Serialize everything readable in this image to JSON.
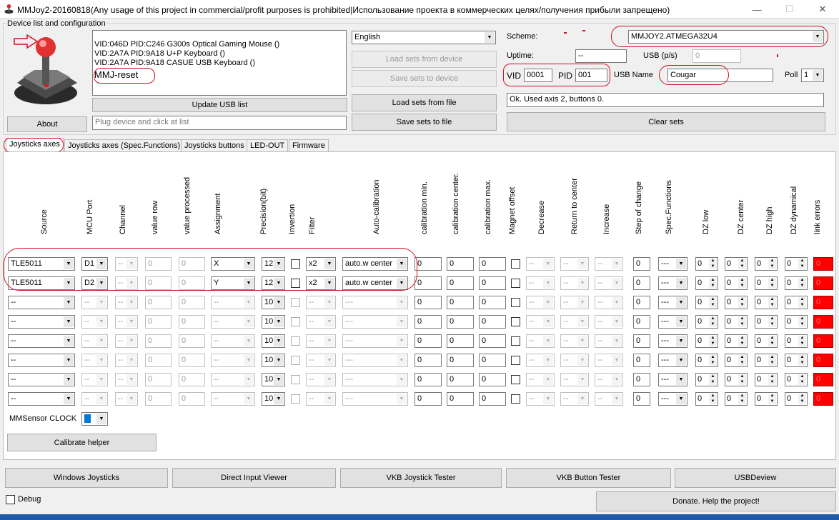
{
  "window": {
    "title": "MMJoy2-20160818(Any usage of this project in commercial/profit purposes is prohibited|Использование проекта в коммерческих целях/получения прибыли запрещено)",
    "minimize": "—",
    "maximize": "☐",
    "close": "✕"
  },
  "device_group": {
    "caption": "Device list and configuration",
    "devices": [
      "VID:046D PID:C246 G300s Optical Gaming Mouse ()",
      "VID:2A7A PID:9A18 U+P Keyboard ()",
      "VID:2A7A PID:9A18 CASUE USB Keyboard ()",
      "MMJ-reset"
    ],
    "about_label": "About",
    "update_usb_label": "Update USB list",
    "plug_placeholder": "Plug device and click at list"
  },
  "middle": {
    "language": "English",
    "load_device_label": "Load sets from device",
    "save_device_label": "Save sets to device",
    "load_file_label": "Load sets from file",
    "save_file_label": "Save sets to file"
  },
  "config": {
    "scheme_label": "Scheme:",
    "scheme_value": "MMJOY2.ATMEGA32U4",
    "uptime_label": "Uptime:",
    "uptime_value": "--",
    "usb_ps_label": "USB (p/s)",
    "usb_ps_value": "0",
    "vid_label": "VID",
    "vid_value": "0001",
    "pid_label": "PID",
    "pid_value": "001",
    "usb_name_label": "USB Name",
    "usb_name_value": "Cougar",
    "poll_label": "Poll",
    "poll_value": "1",
    "status_text": "Ok. Used axis  2, buttons 0.",
    "clear_sets_label": "Clear sets"
  },
  "tabs": [
    "Joysticks axes",
    "Joysticks axes (Spec.Functions)",
    "Joysticks buttons",
    "LED-OUT",
    "Firmware"
  ],
  "columns": [
    "Source",
    "MCU Port",
    "Channel",
    "value row",
    "value processed",
    "Assignment",
    "Precision(bit)",
    "Invertion",
    "Filter",
    "Auto-calibration",
    "calibration min.",
    "calibration center.",
    "calibration max.",
    "Magnet offset",
    "Decrease",
    "Return to center",
    "Increase",
    "Step of change",
    "Spec.Functions",
    "DZ low",
    "DZ center",
    "DZ high",
    "DZ dynamical",
    "link errors"
  ],
  "rows": [
    {
      "source": "TLE5011",
      "port": "D1",
      "channel": "--",
      "raw": "0",
      "proc": "0",
      "assign": "X",
      "prec": "12",
      "filter": "x2",
      "autocal": "auto.w center",
      "cmin": "0",
      "ccen": "0",
      "cmax": "0",
      "dec": "--",
      "ret": "--",
      "inc": "--",
      "step": "0",
      "spec": "---",
      "dzl": "0",
      "dzc": "0",
      "dzh": "0",
      "dzd": "0",
      "err": "0"
    },
    {
      "source": "TLE5011",
      "port": "D2",
      "channel": "--",
      "raw": "0",
      "proc": "0",
      "assign": "Y",
      "prec": "12",
      "filter": "x2",
      "autocal": "auto.w center",
      "cmin": "0",
      "ccen": "0",
      "cmax": "0",
      "dec": "--",
      "ret": "--",
      "inc": "--",
      "step": "0",
      "spec": "---",
      "dzl": "0",
      "dzc": "0",
      "dzh": "0",
      "dzd": "0",
      "err": "0"
    },
    {
      "source": "--",
      "port": "--",
      "channel": "--",
      "raw": "0",
      "proc": "0",
      "assign": "--",
      "prec": "10",
      "filter": "--",
      "autocal": "---",
      "cmin": "0",
      "ccen": "0",
      "cmax": "0",
      "dec": "--",
      "ret": "--",
      "inc": "--",
      "step": "0",
      "spec": "---",
      "dzl": "0",
      "dzc": "0",
      "dzh": "0",
      "dzd": "0",
      "err": "0"
    },
    {
      "source": "--",
      "port": "--",
      "channel": "--",
      "raw": "0",
      "proc": "0",
      "assign": "--",
      "prec": "10",
      "filter": "--",
      "autocal": "---",
      "cmin": "0",
      "ccen": "0",
      "cmax": "0",
      "dec": "--",
      "ret": "--",
      "inc": "--",
      "step": "0",
      "spec": "---",
      "dzl": "0",
      "dzc": "0",
      "dzh": "0",
      "dzd": "0",
      "err": "0"
    },
    {
      "source": "--",
      "port": "--",
      "channel": "--",
      "raw": "0",
      "proc": "0",
      "assign": "--",
      "prec": "10",
      "filter": "--",
      "autocal": "---",
      "cmin": "0",
      "ccen": "0",
      "cmax": "0",
      "dec": "--",
      "ret": "--",
      "inc": "--",
      "step": "0",
      "spec": "---",
      "dzl": "0",
      "dzc": "0",
      "dzh": "0",
      "dzd": "0",
      "err": "0"
    },
    {
      "source": "--",
      "port": "--",
      "channel": "--",
      "raw": "0",
      "proc": "0",
      "assign": "--",
      "prec": "10",
      "filter": "--",
      "autocal": "---",
      "cmin": "0",
      "ccen": "0",
      "cmax": "0",
      "dec": "--",
      "ret": "--",
      "inc": "--",
      "step": "0",
      "spec": "---",
      "dzl": "0",
      "dzc": "0",
      "dzh": "0",
      "dzd": "0",
      "err": "0"
    },
    {
      "source": "--",
      "port": "--",
      "channel": "--",
      "raw": "0",
      "proc": "0",
      "assign": "--",
      "prec": "10",
      "filter": "--",
      "autocal": "---",
      "cmin": "0",
      "ccen": "0",
      "cmax": "0",
      "dec": "--",
      "ret": "--",
      "inc": "--",
      "step": "0",
      "spec": "---",
      "dzl": "0",
      "dzc": "0",
      "dzh": "0",
      "dzd": "0",
      "err": "0"
    },
    {
      "source": "--",
      "port": "--",
      "channel": "--",
      "raw": "0",
      "proc": "0",
      "assign": "--",
      "prec": "10",
      "filter": "--",
      "autocal": "---",
      "cmin": "0",
      "ccen": "0",
      "cmax": "0",
      "dec": "--",
      "ret": "--",
      "inc": "--",
      "step": "0",
      "spec": "---",
      "dzl": "0",
      "dzc": "0",
      "dzh": "0",
      "dzd": "0",
      "err": "0"
    }
  ],
  "mmsensor": {
    "label": "MMSensor CLOCK",
    "value": "2"
  },
  "calibrate_helper_label": "Calibrate helper",
  "bottom_buttons": [
    "Windows Joysticks",
    "Direct Input Viewer",
    "VKB Joystick Tester",
    "VKB Button Tester",
    "USBDeview"
  ],
  "debug_label": "Debug",
  "donate_label": "Donate. Help the project!",
  "icons": {
    "app": "joystick-icon",
    "device": "joystick-icon",
    "pointer": "arrow-right-icon",
    "dropdown": "chevron-down-icon",
    "spin": "spin-arrows-icon"
  },
  "colors": {
    "link_error": "#ff0000",
    "annotation": "#d01020",
    "taskbar": "#1e5aa8"
  }
}
